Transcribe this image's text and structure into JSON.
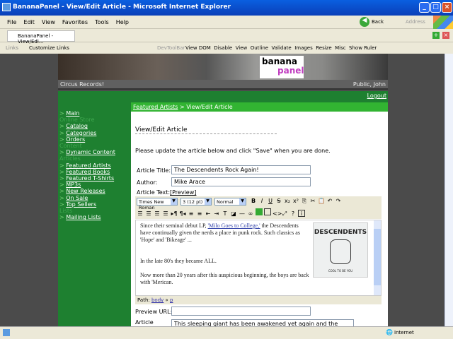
{
  "window": {
    "title": "BananaPanel - View/Edit Article - Microsoft Internet Explorer"
  },
  "menu": [
    "File",
    "Edit",
    "View",
    "Favorites",
    "Tools",
    "Help"
  ],
  "nav": {
    "back": "Back",
    "address": "Address"
  },
  "tab": {
    "label": "BananaPanel - View/Edi..."
  },
  "links": {
    "label": "Links",
    "customize": "Customize Links",
    "devtoolbar": "DevToolBar",
    "items": [
      "View DOM",
      "Disable",
      "View",
      "Outline",
      "Validate",
      "Images",
      "Resize",
      "Misc",
      "Show Ruler"
    ]
  },
  "site": {
    "logo_top": "banana",
    "logo_bottom": "panel",
    "company": "Circus Records!",
    "user": "Public, John",
    "logout": "Logout"
  },
  "sidebar": [
    {
      "type": "link",
      "label": "Main"
    },
    {
      "type": "sec",
      "label": "Online Store"
    },
    {
      "type": "link",
      "label": "Catalog"
    },
    {
      "type": "link",
      "label": "Categories"
    },
    {
      "type": "link",
      "label": "Orders"
    },
    {
      "type": "sec",
      "label": "Content"
    },
    {
      "type": "link",
      "label": "Dynamic Content"
    },
    {
      "type": "sec",
      "label": "Articles"
    },
    {
      "type": "link",
      "label": "Featured Artists"
    },
    {
      "type": "link",
      "label": "Featured Books"
    },
    {
      "type": "link",
      "label": "Featured T-Shirts"
    },
    {
      "type": "link",
      "label": "MP3s"
    },
    {
      "type": "link",
      "label": "New Releases"
    },
    {
      "type": "link",
      "label": "On Sale"
    },
    {
      "type": "link",
      "label": "Top Sellers"
    },
    {
      "type": "sec",
      "label": "Lists"
    },
    {
      "type": "link",
      "label": "Mailing Lists"
    }
  ],
  "main": {
    "crumb_link": "Featured Artists",
    "crumb_rest": " > View/Edit Article",
    "heading": "View/Edit Article",
    "instructions": "Please update the article below and click \"Save\" when you are done.",
    "title_label": "Article Title:",
    "title_value": "The Descendents Rock Again!",
    "author_label": "Author:",
    "author_value": "Mike Arace",
    "text_label": "Article Text:",
    "preview": "[Preview]",
    "font": "Times New Roman",
    "size": "3 (12 pt)",
    "format": "Normal",
    "editor": {
      "p1a": "Since their seminal debut LP, ",
      "p1link": "'Milo Goes to College,'",
      "p1b": " the Descendents have continually given the nerds a place in punk rock. Such classics as 'Hope' and 'Bikeage' ...",
      "p2": "In the late 80's they became ALL.",
      "p3": "Now more than 20 years after this auspicious beginning, the boys are back with 'Merican.",
      "album_title": "DESCENDENTS",
      "album_sub": "COOL TO BE YOU"
    },
    "path_label": "Path:",
    "path_body": "body",
    "path_sep": " » ",
    "path_p": "p",
    "preview_url_label": "Preview URL:",
    "preview_url_value": "",
    "article_label": "Article",
    "article_value": "This sleeping giant has been awakened yet again and the"
  },
  "status": {
    "zone": "Internet"
  }
}
